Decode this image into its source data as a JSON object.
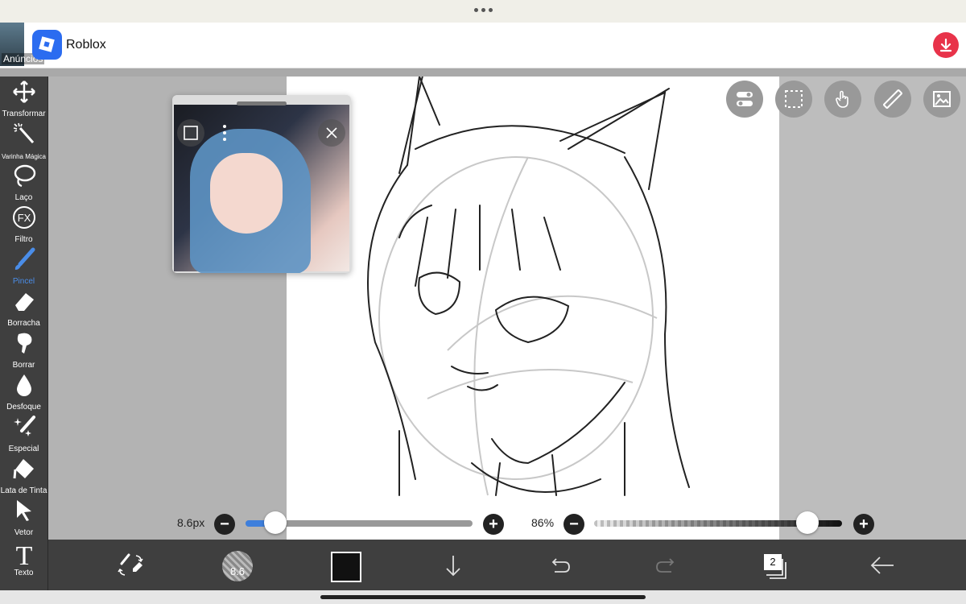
{
  "ad": {
    "label": "Anúncios",
    "app_name": "Roblox",
    "app_icon": "roblox-icon",
    "download_icon": "download-icon",
    "colors": {
      "brand": "#2b6cf0",
      "download": "#e8334a"
    }
  },
  "tools": [
    {
      "id": "transform",
      "label": "Transformar",
      "icon": "move-arrows-icon"
    },
    {
      "id": "magic-wand",
      "label": "Varinha Mágica",
      "icon": "magic-wand-icon"
    },
    {
      "id": "lasso",
      "label": "Laço",
      "icon": "lasso-icon"
    },
    {
      "id": "filter",
      "label": "Filtro",
      "icon": "fx-icon"
    },
    {
      "id": "brush",
      "label": "Pincel",
      "icon": "brush-icon",
      "active": true
    },
    {
      "id": "eraser",
      "label": "Borracha",
      "icon": "eraser-icon"
    },
    {
      "id": "smudge",
      "label": "Borrar",
      "icon": "smudge-icon"
    },
    {
      "id": "blur",
      "label": "Desfoque",
      "icon": "blur-drop-icon"
    },
    {
      "id": "special",
      "label": "Especial",
      "icon": "sparkle-brush-icon"
    },
    {
      "id": "bucket",
      "label": "Lata de Tinta",
      "icon": "paint-bucket-icon"
    },
    {
      "id": "vector",
      "label": "Vetor",
      "icon": "cursor-arrow-icon"
    },
    {
      "id": "text",
      "label": "Texto",
      "icon": "text-icon"
    }
  ],
  "brush": {
    "size_label": "8.6px",
    "size_fraction": 0.13,
    "opacity_label": "86%",
    "opacity_fraction": 0.86,
    "preview_label": "8.6"
  },
  "layers": {
    "count": "2"
  },
  "colors": {
    "active_tool": "#4a8de8",
    "slider_fill": "#3e7fdc",
    "current_color": "#111111"
  }
}
